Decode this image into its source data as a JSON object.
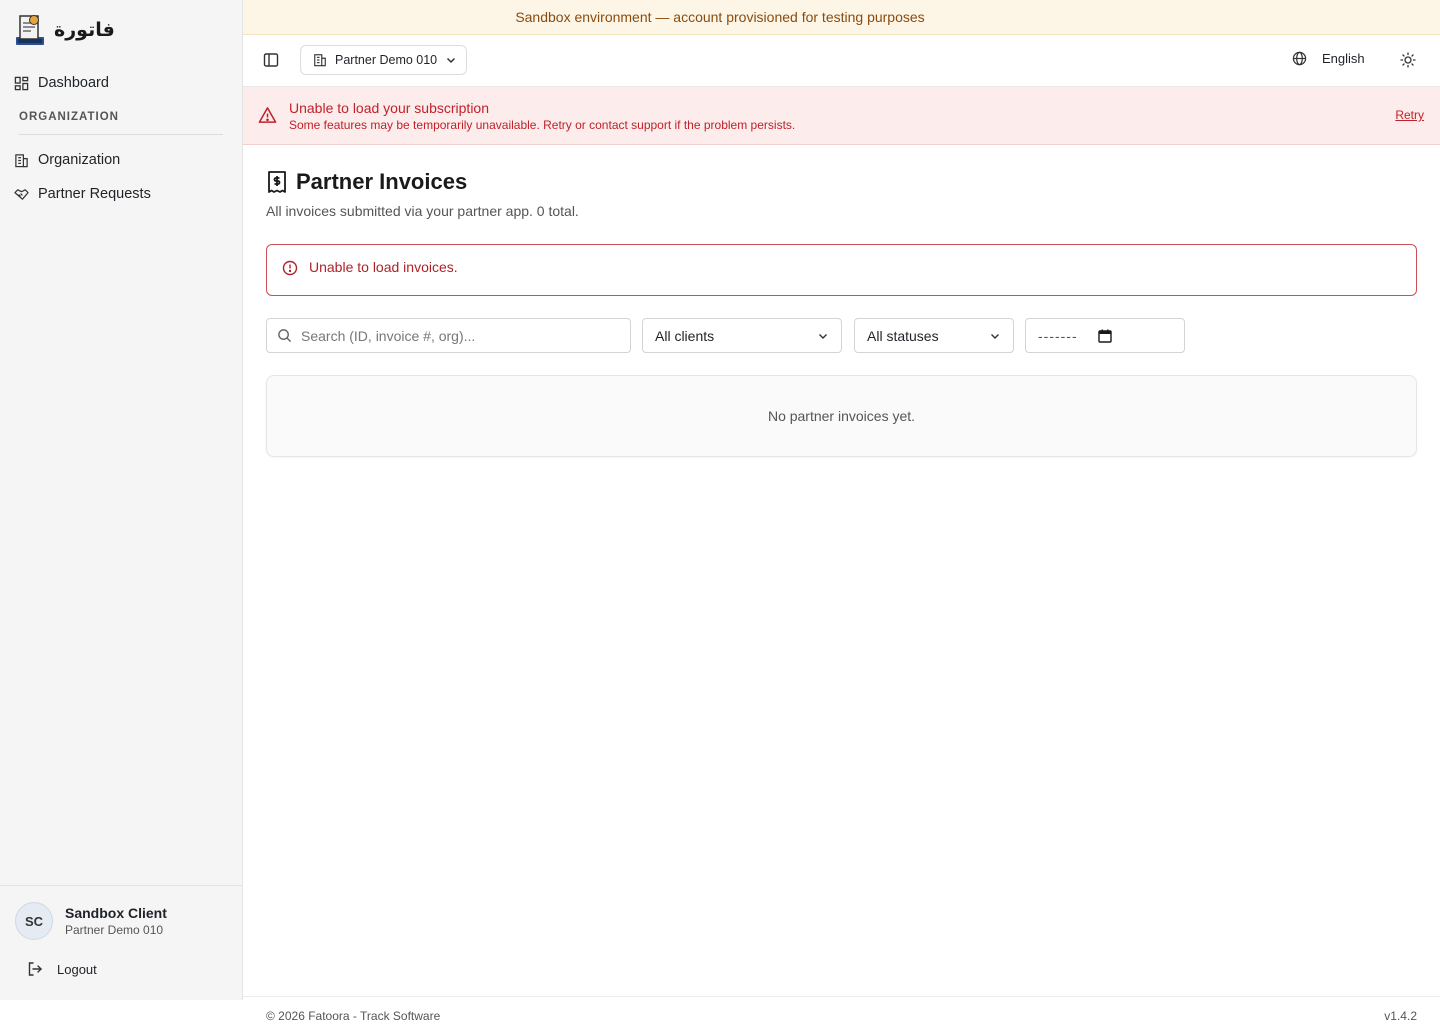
{
  "banner": {
    "text": "Sandbox environment — account provisioned for testing purposes"
  },
  "sidebar": {
    "logo_text": "فاتورة",
    "items": [
      {
        "label": "Dashboard",
        "icon": "dashboard-grid-icon"
      },
      {
        "label": "Organization",
        "icon": "building-icon"
      },
      {
        "label": "Partner Requests",
        "icon": "handshake-icon"
      }
    ],
    "section_label": "ORGANIZATION",
    "user": {
      "initials": "SC",
      "name": "Sandbox Client",
      "org": "Partner Demo 010"
    },
    "logout_label": "Logout"
  },
  "topbar": {
    "org_selector": "Partner Demo 010",
    "language": "English",
    "icons": [
      "sidebar-toggle-icon",
      "building-icon",
      "chevron-down-icon",
      "globe-icon",
      "sun-icon"
    ]
  },
  "subscription_alert": {
    "title": "Unable to load your subscription",
    "description": "Some features may be temporarily unavailable. Retry or contact support if the problem persists.",
    "retry_label": "Retry"
  },
  "page": {
    "title": "Partner Invoices",
    "subtitle": "All invoices submitted via your partner app. 0 total.",
    "error_message": "Unable to load invoices.",
    "filters": {
      "search_placeholder": "Search (ID, invoice #, org)...",
      "clients_selected": "All clients",
      "status_selected": "All statuses",
      "date_placeholder": "-------"
    },
    "empty_message": "No partner invoices yet."
  },
  "footer": {
    "copyright": "© 2026 Fatoora - Track Software",
    "version": "v1.4.2"
  },
  "colors": {
    "error": "#c0222a",
    "banner_bg": "#fdf6e7",
    "banner_text": "#8a4b0f",
    "sidebar_bg": "#f5f5f5"
  }
}
